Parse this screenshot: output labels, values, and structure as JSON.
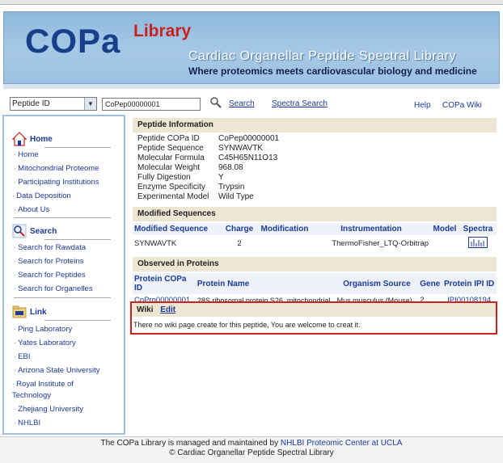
{
  "header": {
    "logo_main": "COPa",
    "logo_sup": "Library",
    "title": "Cardiac Organellar Peptide Spectral Library",
    "subtitle": "Where proteomics meets cardiovascular biology and medicine"
  },
  "searchbar": {
    "select_value": "Peptide ID",
    "input_value": "CoPep00000001",
    "search_label": "Search",
    "spectra_search_label": "Spectra Search",
    "help_label": "Help",
    "wiki_label": "COPa Wiki"
  },
  "sidebar": {
    "home": {
      "title": "Home",
      "items": [
        "Home",
        "Mitochondrial Proteome",
        "Participating Institutions",
        "Data Deposition",
        "About Us"
      ]
    },
    "search": {
      "title": "Search",
      "items": [
        "Search for Rawdata",
        "Search for Proteins",
        "Search for Peptides",
        "Search for Organelles"
      ]
    },
    "link": {
      "title": "Link",
      "items": [
        "Ping Laboratory",
        "Yates Laboratory",
        "EBI",
        "Arizona State University",
        "Royal Institute of Technology",
        "Zhejiang University",
        "NHLBI"
      ]
    }
  },
  "peptide_info": {
    "title": "Peptide Information",
    "rows": [
      {
        "k": "Peptide COPa ID",
        "v": "CoPep00000001"
      },
      {
        "k": "Peptide Sequence",
        "v": "SYNWAVTK"
      },
      {
        "k": "Molecular Formula",
        "v": "C45H65N11O13"
      },
      {
        "k": "Molecular Weight",
        "v": "968.08"
      },
      {
        "k": "Fully Digestion",
        "v": "Y"
      },
      {
        "k": "Enzyme Specificity",
        "v": "Trypsin"
      },
      {
        "k": "Experimental Model",
        "v": "Wild Type"
      }
    ]
  },
  "modified": {
    "title": "Modified Sequences",
    "headers": [
      "Modified Sequence",
      "Charge",
      "Modification",
      "Instrumentation",
      "Model",
      "Spectra"
    ],
    "row": {
      "seq": "SYNWAVTK",
      "charge": "2",
      "modification": "",
      "instrumentation": "ThermoFisher_LTQ-Orbitrap",
      "model": ""
    }
  },
  "observed": {
    "title": "Observed in Proteins",
    "headers": [
      "Protein COPa ID",
      "Protein Name",
      "Organism Source",
      "Gene",
      "Protein IPI ID"
    ],
    "row": {
      "id": "CoPro00000001",
      "name": "28S ribosomal protein S26, mitochondrial",
      "organism": "Mus musculus (Mouse)",
      "gene": "2",
      "ipi": "IPI00108194"
    }
  },
  "wiki": {
    "title": "Wiki",
    "edit_label": "Edit",
    "message": "There no wiki page create for this peptide, You are welcome to creat it."
  },
  "footer": {
    "line1_prefix": "The COPa Library is managed and maintained by",
    "line1_link": "NHLBI Proteomic Center at UCLA",
    "line2": "© Cardiac Organellar Peptide Spectral Library"
  },
  "colors": {
    "accent": "#1a3a9c",
    "panel": "#ece6d2",
    "banner": "#a6c8e6",
    "highlight_border": "#cc2222"
  }
}
